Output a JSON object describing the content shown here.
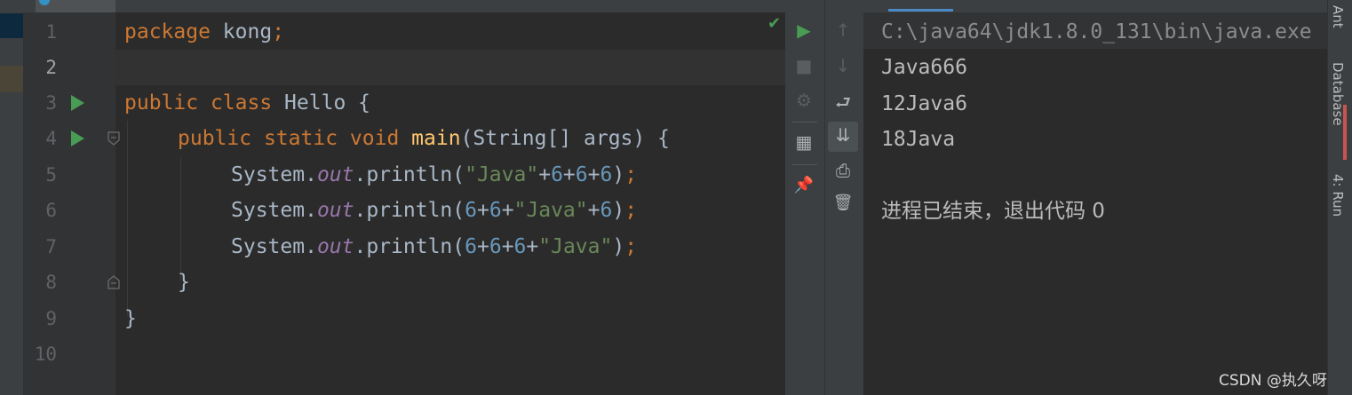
{
  "editor": {
    "line_numbers": [
      "1",
      "2",
      "3",
      "4",
      "5",
      "6",
      "7",
      "8",
      "9",
      "10"
    ],
    "run_markers_lines": [
      3,
      4
    ]
  },
  "code": {
    "l1": {
      "kw": "package",
      "name": " kong",
      "semi": ";"
    },
    "l3": {
      "kw1": "public",
      "kw2": "class",
      "name": " Hello ",
      "brace": "{"
    },
    "l4": {
      "kw1": "public",
      "kw2": "static",
      "kw3": "void",
      "fn": "main",
      "params": "(String[] args) {"
    },
    "l5": {
      "obj": "System.",
      "fld": "out",
      "call": ".println(",
      "str": "\"Java\"",
      "p1": "+",
      "n1": "6",
      "p2": "+",
      "n2": "6",
      "p3": "+",
      "n3": "6",
      "close": ")",
      "semi": ";"
    },
    "l6": {
      "obj": "System.",
      "fld": "out",
      "call": ".println(",
      "n1": "6",
      "p1": "+",
      "n2": "6",
      "p2": "+",
      "str": "\"Java\"",
      "p3": "+",
      "n3": "6",
      "close": ")",
      "semi": ";"
    },
    "l7": {
      "obj": "System.",
      "fld": "out",
      "call": ".println(",
      "n1": "6",
      "p1": "+",
      "n2": "6",
      "p2": "+",
      "n3": "6",
      "p3": "+",
      "str": "\"Java\"",
      "close": ")",
      "semi": ";"
    },
    "l8": {
      "brace": "}"
    },
    "l9": {
      "brace": "}"
    }
  },
  "console": {
    "command": "C:\\java64\\jdk1.8.0_131\\bin\\java.exe",
    "lines": [
      "Java666",
      "12Java6",
      "18Java"
    ],
    "exit_message": "进程已结束，退出代码 0"
  },
  "right_tool_windows": {
    "ant": "Ant",
    "database": "Database",
    "run": "4: Run"
  },
  "watermark": "CSDN @执久呀",
  "icons": {
    "check": "✔",
    "rerun": "▶",
    "stop": "■",
    "up": "↑",
    "down": "↓",
    "soft_wrap": "⮐",
    "scroll_end": "⇊",
    "print": "⎙",
    "trash": "🗑",
    "layout": "▦",
    "pin": "📌",
    "settings_bug": "⚙"
  },
  "colors": {
    "keyword": "#cc7832",
    "function": "#ffc66d",
    "string": "#6a8759",
    "number": "#6897bb",
    "field": "#9876aa",
    "run_green": "#499c54"
  }
}
